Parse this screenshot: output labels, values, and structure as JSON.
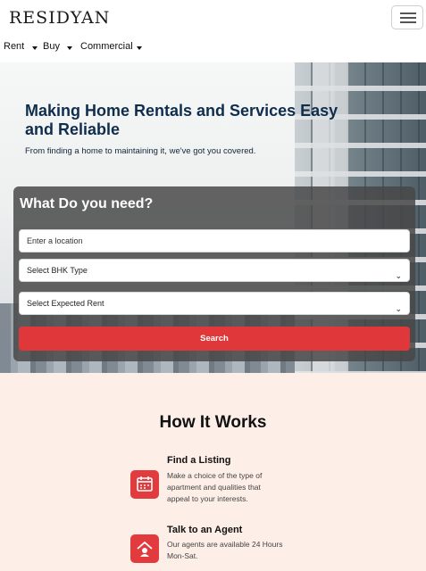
{
  "header": {
    "brand": "RESIDYAN",
    "menu_icon": "hamburger-icon"
  },
  "nav": {
    "items": [
      {
        "label": "Rent"
      },
      {
        "label": "Buy"
      },
      {
        "label": "Commercial"
      }
    ]
  },
  "hero": {
    "headline": "Making Home Rentals and Services Easy and Reliable",
    "subheadline": "From finding a home to maintaining it, we've got you covered."
  },
  "search_panel": {
    "title": "What Do you need?",
    "location_placeholder": "Enter a location",
    "bhk_selected": "Select BHK Type",
    "rent_selected": "Select Expected Rent",
    "search_label": "Search"
  },
  "how_it_works": {
    "title": "How It Works",
    "steps": [
      {
        "title": "Find a Listing",
        "text": "Make a choice of the type of apartment and qualities that appeal to your interests.",
        "icon": "calendar-icon"
      },
      {
        "title": "Talk to an Agent",
        "text": "Our agents are available 24 Hours Mon-Sat.",
        "icon": "home-agent-icon"
      }
    ]
  },
  "colors": {
    "accent": "#e0383a",
    "headline": "#0f2d4d",
    "section_bg": "#fdeee7"
  }
}
